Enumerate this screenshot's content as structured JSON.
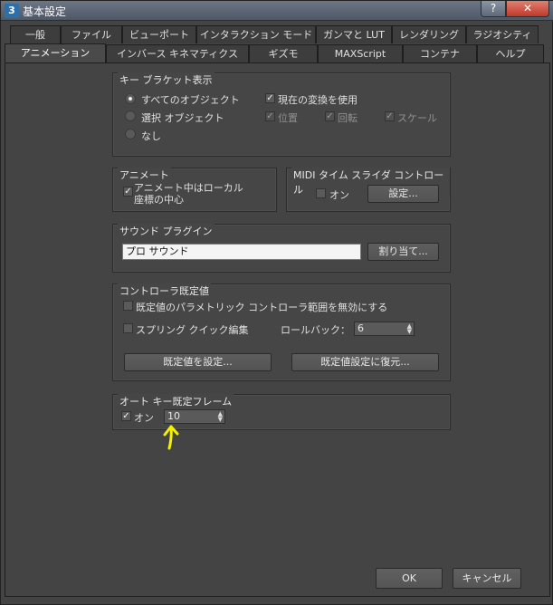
{
  "window": {
    "title": "基本設定",
    "app_icon_label": "3",
    "help_button": "?",
    "close_button": "✕"
  },
  "tabs_row1": [
    "一般",
    "ファイル",
    "ビューポート",
    "インタラクション モード",
    "ガンマと LUT",
    "レンダリング",
    "ラジオシティ"
  ],
  "tabs_row2": [
    "アニメーション",
    "インバース キネマティクス",
    "ギズモ",
    "MAXScript",
    "コンテナ",
    "ヘルプ"
  ],
  "active_tab": "アニメーション",
  "key_bracket": {
    "label": "キー ブラケット表示",
    "radio_all": "すべてのオブジェクト",
    "radio_selected": "選択 オブジェクト",
    "radio_none": "なし",
    "use_current_transform": "現在の変換を使用",
    "position": "位置",
    "rotation": "回転",
    "scale": "スケール"
  },
  "animate": {
    "label": "アニメート",
    "local_center_line1": "アニメート中はローカル",
    "local_center_line2": "座標の中心"
  },
  "midi": {
    "label": "MIDI タイム スライダ コントロール",
    "on": "オン",
    "setup_button": "設定..."
  },
  "sound": {
    "label": "サウンド プラグイン",
    "plugin_value": "プロ サウンド",
    "assign_button": "割り当て..."
  },
  "controller_defaults": {
    "label": "コントローラ既定値",
    "disable_param_range": "既定値のパラメトリック コントローラ範囲を無効にする",
    "spring_quick_edit": "スプリング クイック編集",
    "rollback_label": "ロールバック：",
    "rollback_value": "6",
    "set_defaults_button": "既定値を設定...",
    "restore_defaults_button": "既定値設定に復元..."
  },
  "auto_key": {
    "label": "オート キー既定フレーム",
    "on": "オン",
    "frame_value": "10"
  },
  "footer": {
    "ok_button": "OK",
    "cancel_button": "キャンセル"
  },
  "colors": {
    "annotation_arrow": "#f5f000",
    "background": "#444444"
  }
}
